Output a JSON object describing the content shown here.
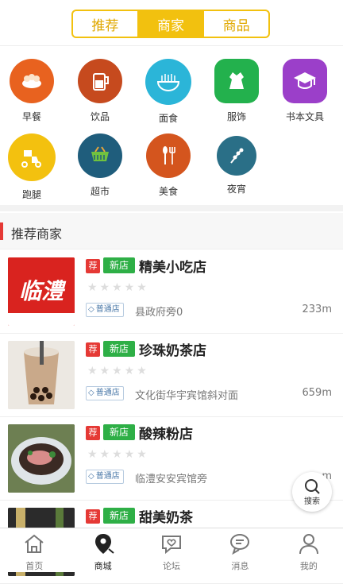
{
  "top_tabs": [
    "推荐",
    "商家",
    "商品"
  ],
  "categories": [
    {
      "label": "早餐",
      "icon": "breakfast-icon",
      "color": "#e8621f"
    },
    {
      "label": "饮品",
      "icon": "drink-icon",
      "color": "#c64a1e"
    },
    {
      "label": "面食",
      "icon": "noodle-icon",
      "color": "#2bb5d8"
    },
    {
      "label": "服饰",
      "icon": "clothing-icon",
      "color": "#23b14d"
    },
    {
      "label": "书本文具",
      "icon": "book-icon",
      "color": "#9b3fc9"
    },
    {
      "label": "跑腿",
      "icon": "delivery-icon",
      "color": "#f3c10f"
    },
    {
      "label": "超市",
      "icon": "supermarket-icon",
      "color": "#1f5d7c"
    },
    {
      "label": "美食",
      "icon": "food-icon",
      "color": "#d4551e"
    },
    {
      "label": "夜宵",
      "icon": "night-snack-icon",
      "color": "#2a6f87"
    }
  ],
  "section": {
    "title": "推荐商家"
  },
  "tag_labels": {
    "jian": "荐",
    "new": "新店",
    "store_type": "普通店"
  },
  "stores": [
    {
      "name": "精美小吃店",
      "address": "县政府旁0",
      "distance": "233m",
      "thumb_text": "临澧"
    },
    {
      "name": "珍珠奶茶店",
      "address": "文化街华宇宾馆斜对面",
      "distance": "659m"
    },
    {
      "name": "酸辣粉店",
      "address": "临澧安安宾馆旁",
      "distance": "m"
    },
    {
      "name": "甜美奶茶",
      "address": "",
      "distance": ""
    }
  ],
  "float_search": {
    "label": "搜索"
  },
  "bottom_nav": [
    "首页",
    "商城",
    "论坛",
    "消息",
    "我的"
  ]
}
